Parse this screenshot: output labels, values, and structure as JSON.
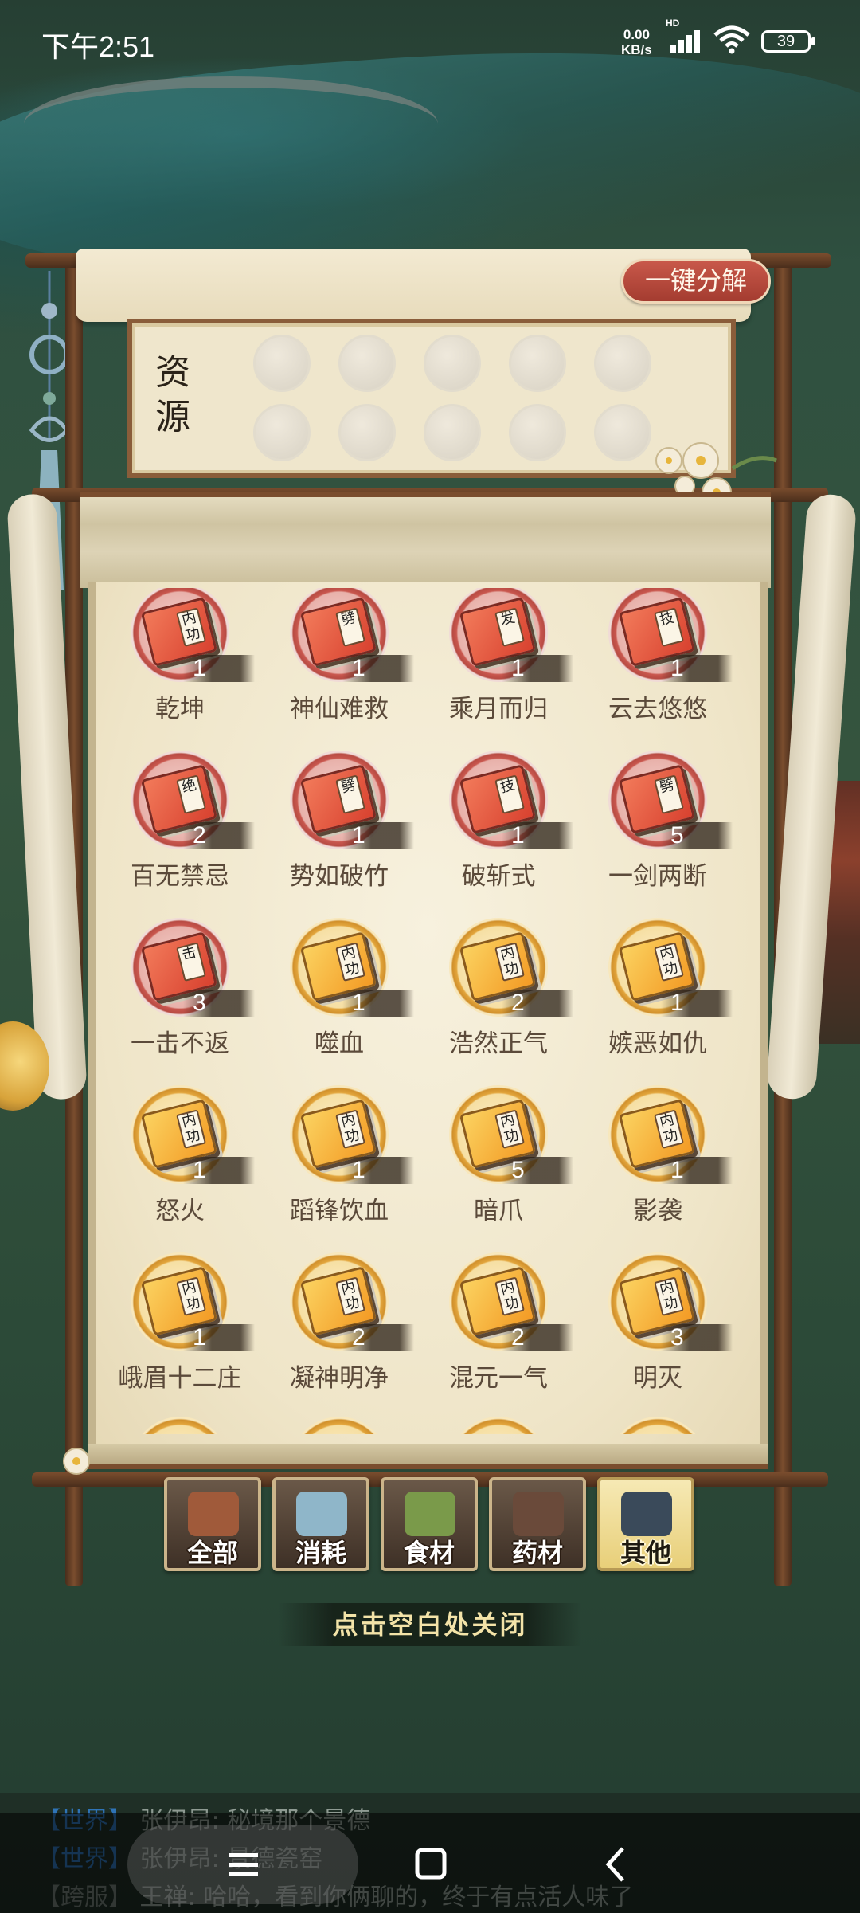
{
  "status_bar": {
    "time": "下午2:51",
    "net_speed_value": "0.00",
    "net_speed_unit": "KB/s",
    "signal_tag": "HD",
    "battery": "39"
  },
  "panel": {
    "decompose_button": "一键分解",
    "resource_label": "资源",
    "items": [
      {
        "name": "乾坤",
        "count": "1",
        "tier": "red",
        "tag": "内功"
      },
      {
        "name": "神仙难救",
        "count": "1",
        "tier": "red",
        "tag": "劈"
      },
      {
        "name": "乘月而归",
        "count": "1",
        "tier": "red",
        "tag": "发"
      },
      {
        "name": "云去悠悠",
        "count": "1",
        "tier": "red",
        "tag": "技"
      },
      {
        "name": "百无禁忌",
        "count": "2",
        "tier": "red",
        "tag": "绝"
      },
      {
        "name": "势如破竹",
        "count": "1",
        "tier": "red",
        "tag": "劈"
      },
      {
        "name": "破斩式",
        "count": "1",
        "tier": "red",
        "tag": "技"
      },
      {
        "name": "一剑两断",
        "count": "5",
        "tier": "red",
        "tag": "劈"
      },
      {
        "name": "一击不返",
        "count": "3",
        "tier": "red",
        "tag": "击"
      },
      {
        "name": "噬血",
        "count": "1",
        "tier": "gold",
        "tag": "内功"
      },
      {
        "name": "浩然正气",
        "count": "2",
        "tier": "gold",
        "tag": "内功"
      },
      {
        "name": "嫉恶如仇",
        "count": "1",
        "tier": "gold",
        "tag": "内功"
      },
      {
        "name": "怒火",
        "count": "1",
        "tier": "gold",
        "tag": "内功"
      },
      {
        "name": "蹈锋饮血",
        "count": "1",
        "tier": "gold",
        "tag": "内功"
      },
      {
        "name": "暗爪",
        "count": "5",
        "tier": "gold",
        "tag": "内功"
      },
      {
        "name": "影袭",
        "count": "1",
        "tier": "gold",
        "tag": "内功"
      },
      {
        "name": "峨眉十二庄",
        "count": "1",
        "tier": "gold",
        "tag": "内功"
      },
      {
        "name": "凝神明净",
        "count": "2",
        "tier": "gold",
        "tag": "内功"
      },
      {
        "name": "混元一气",
        "count": "2",
        "tier": "gold",
        "tag": "内功"
      },
      {
        "name": "明灭",
        "count": "3",
        "tier": "gold",
        "tag": "内功"
      }
    ]
  },
  "tabs": [
    {
      "label": "全部",
      "icon": "treasure-chest-icon",
      "active": false
    },
    {
      "label": "消耗",
      "icon": "potion-bottle-icon",
      "active": false
    },
    {
      "label": "食材",
      "icon": "vegetable-basket-icon",
      "active": false
    },
    {
      "label": "药材",
      "icon": "herb-pot-icon",
      "active": false
    },
    {
      "label": "其他",
      "icon": "treasure-pot-icon",
      "active": true
    }
  ],
  "close_hint": "点击空白处关闭",
  "chat": [
    {
      "channel": "【世界】",
      "speaker": "张伊昂",
      "text": "秘境那个景德"
    },
    {
      "channel": "【世界】",
      "speaker": "张伊昂",
      "text": "景德瓷窑"
    },
    {
      "channel": "【跨服】",
      "speaker": "王禅",
      "text": "哈哈，看到你俩聊的，终于有点活人味了"
    }
  ],
  "colors": {
    "accent_red": "#b84b43",
    "accent_gold": "#e2a53c",
    "parchment": "#efe5c8",
    "frame_wood": "#7a4d2e"
  }
}
